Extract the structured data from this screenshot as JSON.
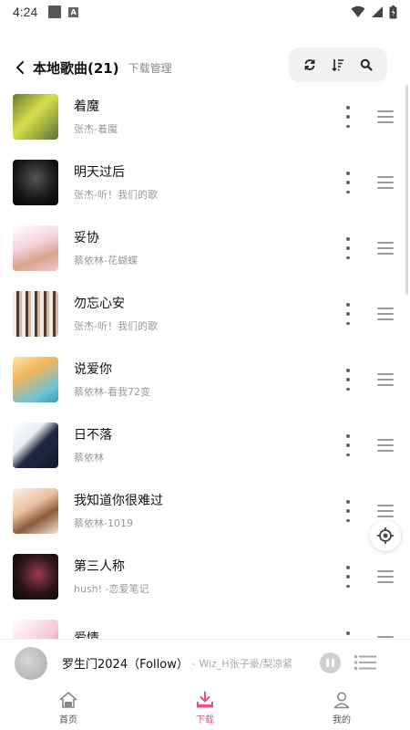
{
  "status_bar": {
    "time": "4:24"
  },
  "header": {
    "title": "本地歌曲(21)",
    "subtitle": "下载管理"
  },
  "songs": [
    {
      "title": "着魔",
      "artist": "张杰-着魔"
    },
    {
      "title": "明天过后",
      "artist": "张杰-听！我们的歌"
    },
    {
      "title": "妥协",
      "artist": "蔡依林-花蝴蝶"
    },
    {
      "title": "勿忘心安",
      "artist": "张杰-听！我们的歌"
    },
    {
      "title": "说爱你",
      "artist": "蔡依林-看我72变"
    },
    {
      "title": "日不落",
      "artist": "蔡依林"
    },
    {
      "title": "我知道你很难过",
      "artist": "蔡依林-1019"
    },
    {
      "title": "第三人称",
      "artist": "hush! -恋爱笔记"
    },
    {
      "title": "爱情",
      "artist": ""
    }
  ],
  "player": {
    "title": "罗生门2024（Follow）",
    "artist": "- Wiz_H张子豪/梨凉紧"
  },
  "nav": [
    {
      "label": "首页"
    },
    {
      "label": "下载"
    },
    {
      "label": "我的"
    }
  ],
  "colors": {
    "accent": "#e8517a",
    "icon": "#333333",
    "muted": "#999999"
  }
}
